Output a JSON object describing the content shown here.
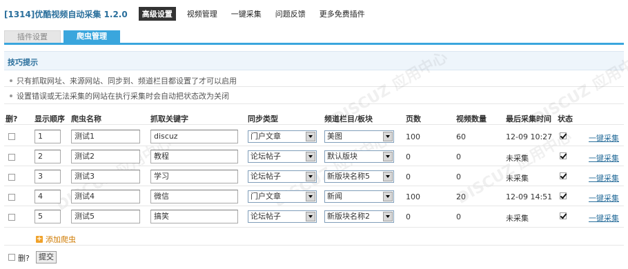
{
  "app": {
    "title": "[1314]优酷视频自动采集 1.2.0",
    "nav": [
      "高级设置",
      "视频管理",
      "一键采集",
      "问题反馈",
      "更多免费插件"
    ],
    "nav_active": 0
  },
  "tabs": [
    {
      "label": "插件设置",
      "active": false
    },
    {
      "label": "爬虫管理",
      "active": true
    }
  ],
  "tips": {
    "title": "技巧提示",
    "items": [
      "只有抓取网址、来源网站、同步到、频道栏目都设置了才可以启用",
      "设置错误或无法采集的网站在执行采集时会自动把状态改为关闭"
    ]
  },
  "table": {
    "headers": [
      "删?",
      "显示顺序",
      "爬虫名称",
      "抓取关键字",
      "同步类型",
      "频道栏目/板块",
      "页数",
      "视频数量",
      "最后采集时间",
      "状态"
    ],
    "rows": [
      {
        "order": "1",
        "name": "测试1",
        "keyword": "discuz",
        "sync": "门户文章",
        "channel": "美图",
        "pages": "100",
        "videos": "60",
        "last": "12-09 10:27",
        "status": true,
        "action": "一键采集"
      },
      {
        "order": "2",
        "name": "测试2",
        "keyword": "教程",
        "sync": "论坛帖子",
        "channel": "默认版块",
        "pages": "0",
        "videos": "0",
        "last": "未采集",
        "status": true,
        "action": "一键采集"
      },
      {
        "order": "3",
        "name": "测试3",
        "keyword": "学习",
        "sync": "论坛帖子",
        "channel": "新版块名称5",
        "pages": "0",
        "videos": "0",
        "last": "未采集",
        "status": true,
        "action": "一键采集"
      },
      {
        "order": "4",
        "name": "测试4",
        "keyword": "微信",
        "sync": "门户文章",
        "channel": "新闻",
        "pages": "100",
        "videos": "20",
        "last": "12-09 14:51",
        "status": true,
        "action": "一键采集"
      },
      {
        "order": "5",
        "name": "测试5",
        "keyword": "搞笑",
        "sync": "论坛帖子",
        "channel": "新版块名称2",
        "pages": "0",
        "videos": "0",
        "last": "未采集",
        "status": true,
        "action": "一键采集"
      }
    ]
  },
  "add_label": "添加爬虫",
  "footer": {
    "delete_label": "删?",
    "submit_label": "提交"
  },
  "colors": {
    "accent": "#3aa6dd",
    "title": "#2a6f9c",
    "add": "#cf7a00"
  }
}
